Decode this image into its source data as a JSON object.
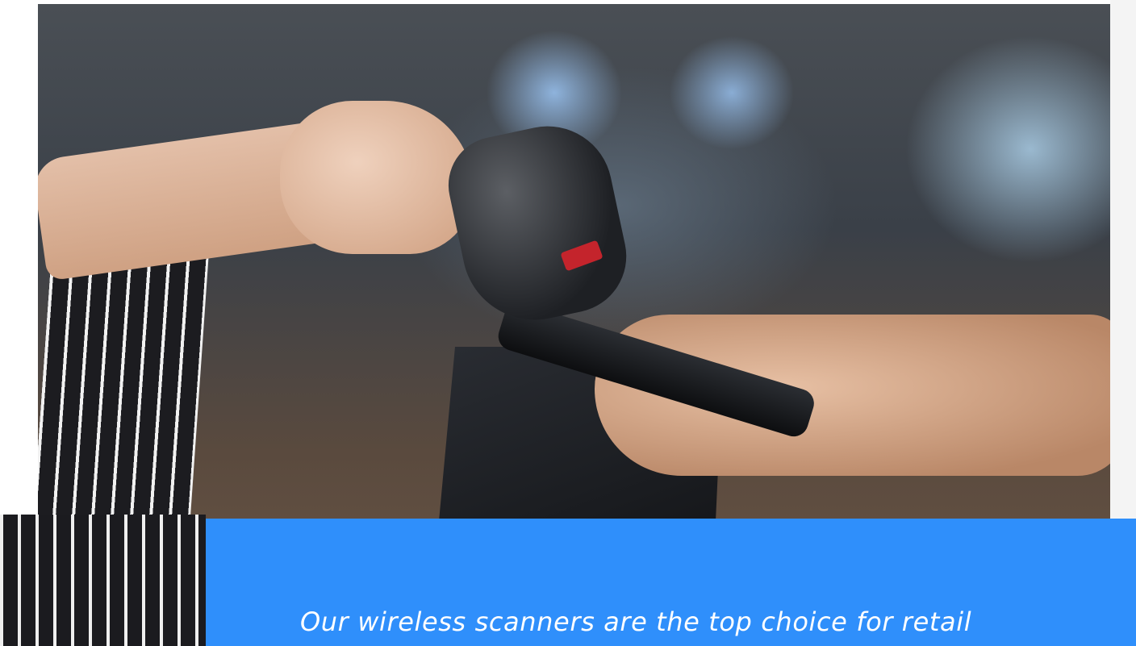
{
  "hero_image": {
    "alt": "Barista scanning a customer's phone with a wireless barcode scanner at a counter",
    "accent": "#2f8ffb"
  },
  "banner": {
    "tagline": "Our wireless scanners are the top choice for retail"
  }
}
